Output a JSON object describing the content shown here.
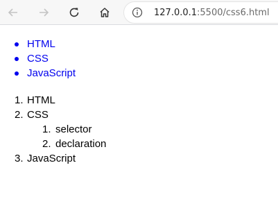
{
  "browser": {
    "url_host": "127.0.0.1",
    "url_rest": ":5500/css6.html"
  },
  "page": {
    "unordered_links": [
      {
        "label": "HTML"
      },
      {
        "label": "CSS"
      },
      {
        "label": "JavaScript"
      }
    ],
    "ordered_list": [
      {
        "marker": "1.",
        "label": "HTML"
      },
      {
        "marker": "2.",
        "label": "CSS",
        "sub_items": [
          {
            "marker": "1.",
            "label": "selector"
          },
          {
            "marker": "2.",
            "label": "declaration"
          }
        ]
      },
      {
        "marker": "3.",
        "label": "JavaScript"
      }
    ]
  },
  "colors": {
    "link": "#0000ee",
    "toolbar_bg": "#f7f7f7"
  },
  "icons": [
    "back-arrow-icon",
    "forward-arrow-icon",
    "reload-icon",
    "home-icon",
    "info-icon"
  ]
}
